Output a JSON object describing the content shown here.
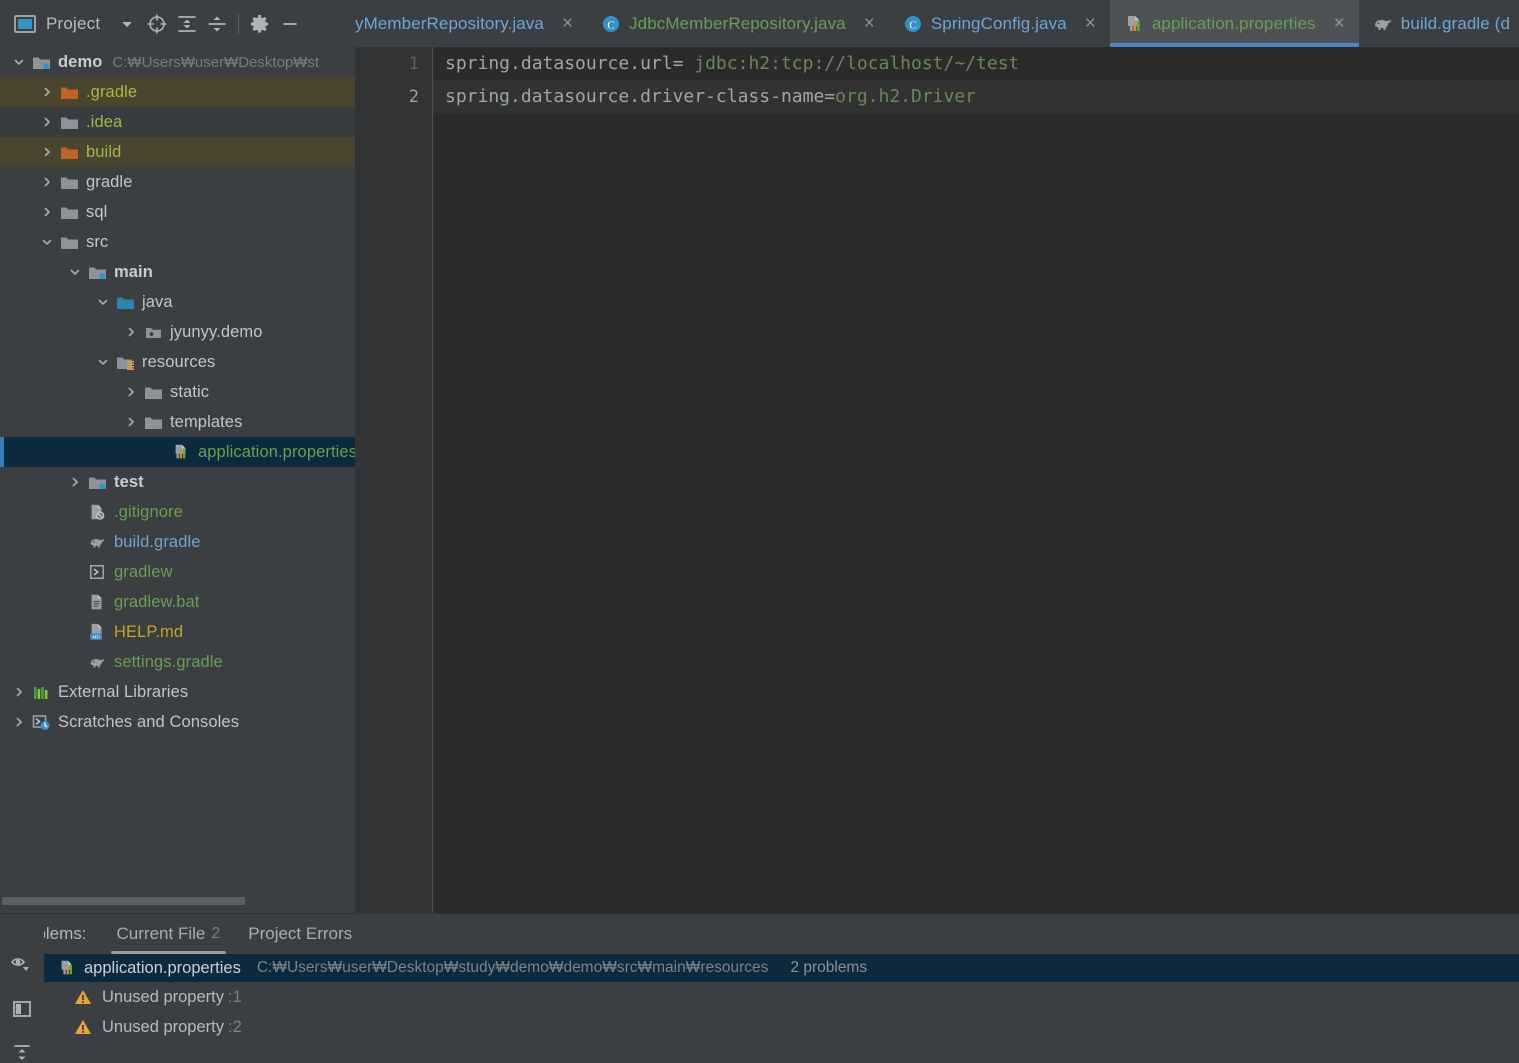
{
  "toolbar": {
    "project_label": "Project",
    "window_icon": "project-window-icon",
    "buttons": [
      {
        "name": "chevron-down-icon",
        "tip": "Show Options Menu"
      },
      {
        "name": "locate-crosshair-icon",
        "tip": "Select Opened File"
      },
      {
        "name": "expand-all-icon",
        "tip": "Expand All"
      },
      {
        "name": "collapse-all-icon",
        "tip": "Collapse All"
      },
      {
        "name": "gear-icon",
        "tip": "Settings"
      },
      {
        "name": "minimize-icon",
        "tip": "Hide"
      }
    ]
  },
  "editor_tabs": [
    {
      "label": "yMemberRepository.java",
      "icon": "java-class-icon",
      "color": "blue",
      "active": false,
      "truncated_left": true,
      "close": "×"
    },
    {
      "label": "JdbcMemberRepository.java",
      "icon": "java-class-icon",
      "color": "green",
      "active": false,
      "close": "×"
    },
    {
      "label": "SpringConfig.java",
      "icon": "java-class-icon",
      "color": "blue",
      "active": false,
      "close": "×"
    },
    {
      "label": "application.properties",
      "icon": "properties-file-icon",
      "color": "green",
      "active": true,
      "close": "×"
    },
    {
      "label": "build.gradle (d",
      "icon": "gradle-elephant-icon",
      "color": "blue",
      "active": false,
      "truncated_right": true,
      "close": ""
    }
  ],
  "tree": {
    "root": {
      "label": "demo",
      "path": "C:₩Users₩user₩Desktop₩st",
      "icon": "module-folder-icon",
      "expanded": true
    },
    "items": [
      {
        "label": ".gradle",
        "indent": 1,
        "icon": "folder-orange-icon",
        "twisty": "collapsed",
        "color": "yellowgreen",
        "highlight": "orange"
      },
      {
        "label": ".idea",
        "indent": 1,
        "icon": "folder-gray-icon",
        "twisty": "collapsed",
        "color": "yellowgreen",
        "highlight": "dark"
      },
      {
        "label": "build",
        "indent": 1,
        "icon": "folder-orange-icon",
        "twisty": "collapsed",
        "color": "yellowgreen",
        "highlight": "orange"
      },
      {
        "label": "gradle",
        "indent": 1,
        "icon": "folder-gray-icon",
        "twisty": "collapsed",
        "color": "white",
        "highlight": "none"
      },
      {
        "label": "sql",
        "indent": 1,
        "icon": "folder-gray-icon",
        "twisty": "collapsed",
        "color": "white",
        "highlight": "none"
      },
      {
        "label": "src",
        "indent": 1,
        "icon": "folder-gray-icon",
        "twisty": "expanded",
        "color": "white",
        "highlight": "none"
      },
      {
        "label": "main",
        "indent": 2,
        "icon": "module-folder-icon",
        "twisty": "expanded",
        "color": "bold",
        "highlight": "none"
      },
      {
        "label": "java",
        "indent": 3,
        "icon": "folder-blue-icon",
        "twisty": "expanded",
        "color": "white",
        "highlight": "none"
      },
      {
        "label": "jyunyy.demo",
        "indent": 4,
        "icon": "package-icon",
        "twisty": "collapsed",
        "color": "white",
        "highlight": "none"
      },
      {
        "label": "resources",
        "indent": 3,
        "icon": "resources-folder-icon",
        "twisty": "expanded",
        "color": "white",
        "highlight": "none"
      },
      {
        "label": "static",
        "indent": 4,
        "icon": "folder-gray-icon",
        "twisty": "collapsed",
        "color": "white",
        "highlight": "none"
      },
      {
        "label": "templates",
        "indent": 4,
        "icon": "folder-gray-icon",
        "twisty": "collapsed",
        "color": "white",
        "highlight": "none"
      },
      {
        "label": "application.properties",
        "indent": 5,
        "icon": "properties-file-icon",
        "twisty": "none",
        "color": "green",
        "highlight": "selected"
      },
      {
        "label": "test",
        "indent": 2,
        "icon": "module-folder-icon",
        "twisty": "collapsed",
        "color": "bold",
        "highlight": "none"
      },
      {
        "label": ".gitignore",
        "indent": 2,
        "icon": "gitignore-icon",
        "twisty": "none",
        "color": "green",
        "highlight": "none"
      },
      {
        "label": "build.gradle",
        "indent": 2,
        "icon": "gradle-elephant-icon",
        "twisty": "none",
        "color": "blue",
        "highlight": "none"
      },
      {
        "label": "gradlew",
        "indent": 2,
        "icon": "script-icon",
        "twisty": "none",
        "color": "green",
        "highlight": "none"
      },
      {
        "label": "gradlew.bat",
        "indent": 2,
        "icon": "bat-file-icon",
        "twisty": "none",
        "color": "green",
        "highlight": "none"
      },
      {
        "label": "HELP.md",
        "indent": 2,
        "icon": "markdown-file-icon",
        "twisty": "none",
        "color": "gold",
        "highlight": "none"
      },
      {
        "label": "settings.gradle",
        "indent": 2,
        "icon": "gradle-elephant-icon",
        "twisty": "none",
        "color": "green",
        "highlight": "none"
      },
      {
        "label": "External Libraries",
        "indent": 0,
        "icon": "libraries-icon",
        "twisty": "collapsed",
        "color": "white",
        "highlight": "none"
      },
      {
        "label": "Scratches and Consoles",
        "indent": 0,
        "icon": "scratches-icon",
        "twisty": "collapsed",
        "color": "white",
        "highlight": "none"
      }
    ]
  },
  "editor": {
    "lines": [
      {
        "number": "1",
        "key": "spring.datasource.url=",
        "value": " jdbc:h2:tcp://localhost/~/test",
        "current": false
      },
      {
        "number": "2",
        "key": "spring.datasource.driver-class-name=",
        "value": "org.h2.Driver",
        "current": true
      }
    ]
  },
  "problems_panel": {
    "title": "Problems:",
    "tabs": [
      {
        "label": "Current File",
        "count": "2",
        "active": true
      },
      {
        "label": "Project Errors",
        "count": "",
        "active": false
      }
    ],
    "file": {
      "name": "application.properties",
      "icon": "properties-file-icon",
      "path": "C:₩Users₩user₩Desktop₩study₩demo₩demo₩src₩main₩resources",
      "count_label": "2 problems"
    },
    "items": [
      {
        "icon": "warning-triangle-icon",
        "text": "Unused property",
        "location": ":1"
      },
      {
        "icon": "warning-triangle-icon",
        "text": "Unused property",
        "location": ":2"
      }
    ],
    "sidebar_icons": [
      {
        "name": "eye-view-options-icon"
      },
      {
        "name": "split-panel-icon"
      },
      {
        "name": "collapse-all-icon"
      }
    ]
  },
  "colors": {
    "accent_blue": "#4a88c7",
    "selection_navy": "#0d293e",
    "highlight_orange": "#4b452f",
    "editor_bg": "#2b2b2b",
    "panel_bg": "#3c3f41",
    "string_green": "#6a8759",
    "warning_amber": "#e8a33d"
  }
}
